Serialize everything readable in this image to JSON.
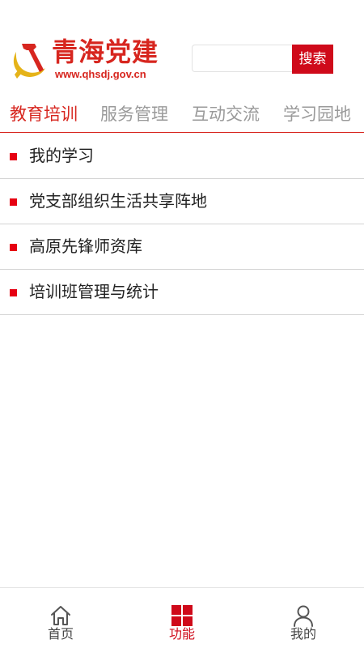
{
  "header": {
    "logo_title": "青海党建",
    "logo_url": "www.qhsdj.gov.cn",
    "search_placeholder": "",
    "search_value": "",
    "search_button_label": "搜索",
    "emblem_icon": "party-emblem-icon"
  },
  "tabs": [
    {
      "label": "教育培训",
      "active": true
    },
    {
      "label": "服务管理",
      "active": false
    },
    {
      "label": "互动交流",
      "active": false
    },
    {
      "label": "学习园地",
      "active": false
    }
  ],
  "list": [
    {
      "label": "我的学习"
    },
    {
      "label": "党支部组织生活共享阵地"
    },
    {
      "label": "高原先锋师资库"
    },
    {
      "label": "培训班管理与统计"
    }
  ],
  "bottom_nav": [
    {
      "label": "首页",
      "icon": "home-icon",
      "active": false
    },
    {
      "label": "功能",
      "icon": "grid-icon",
      "active": true
    },
    {
      "label": "我的",
      "icon": "user-icon",
      "active": false
    }
  ],
  "colors": {
    "brand_red": "#d7261f",
    "button_red": "#cf0a1a",
    "bullet_red": "#e60012",
    "inactive_tab": "#9a9a9a"
  }
}
